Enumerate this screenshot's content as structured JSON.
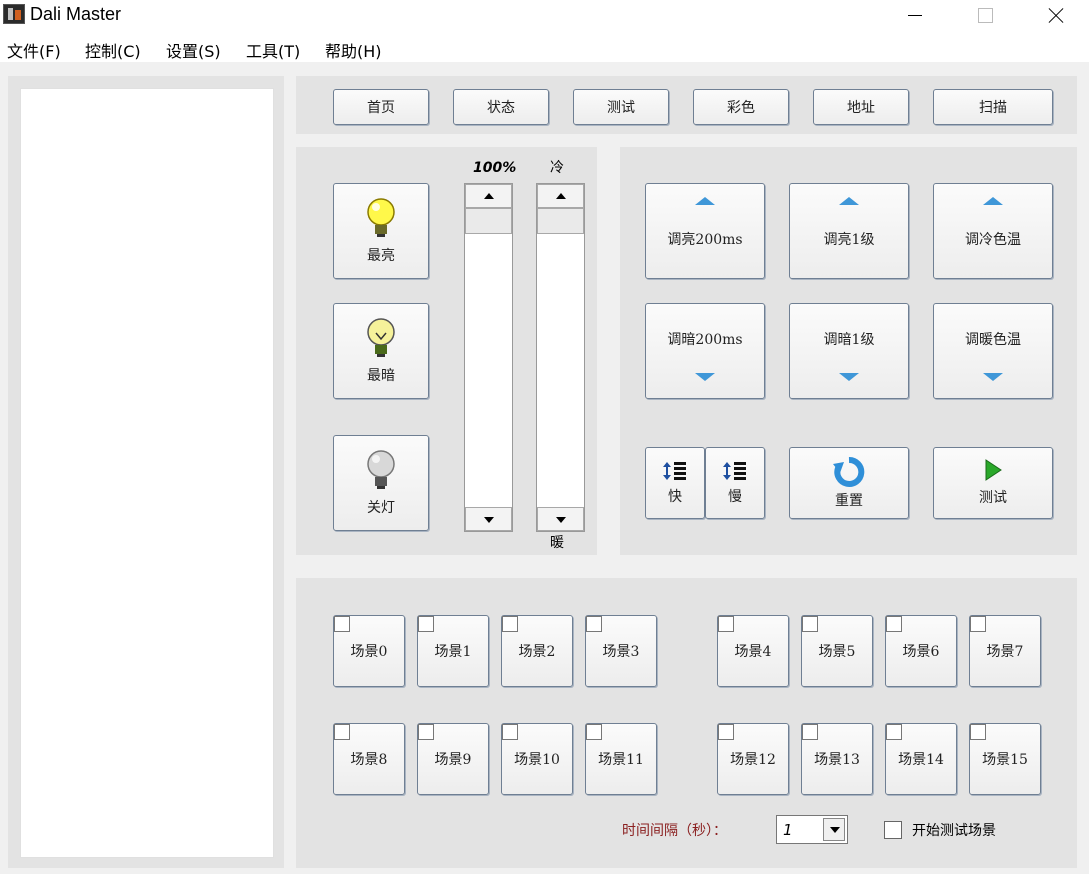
{
  "window": {
    "title": "Dali Master"
  },
  "menu": [
    "文件(F)",
    "控制(C)",
    "设置(S)",
    "工具(T)",
    "帮助(H)"
  ],
  "nav_tabs": [
    "首页",
    "状态",
    "测试",
    "彩色",
    "地址",
    "扫描"
  ],
  "brightness_panel": {
    "brightest": "最亮",
    "darkest": "最暗",
    "off": "关灯",
    "level_label": "100%",
    "cool_label": "冷",
    "warm_label": "暖"
  },
  "adjust_panel": {
    "dim_up_200ms": "调亮200ms",
    "dim_up_step": "调亮1级",
    "cooler": "调冷色温",
    "dim_down_200ms": "调暗200ms",
    "dim_down_step": "调暗1级",
    "warmer": "调暖色温",
    "fast": "快",
    "slow": "慢",
    "reset": "重置",
    "test": "测试"
  },
  "scenes": [
    "场景0",
    "场景1",
    "场景2",
    "场景3",
    "场景4",
    "场景5",
    "场景6",
    "场景7",
    "场景8",
    "场景9",
    "场景10",
    "场景11",
    "场景12",
    "场景13",
    "场景14",
    "场景15"
  ],
  "interval": {
    "label": "时间间隔（秒）：",
    "value": "1"
  },
  "start_test_scene": "开始测试场景",
  "colors": {
    "interval_label": "#8b2020",
    "arrow_blue": "#3f97d8",
    "panel": "#e3e3e3"
  }
}
